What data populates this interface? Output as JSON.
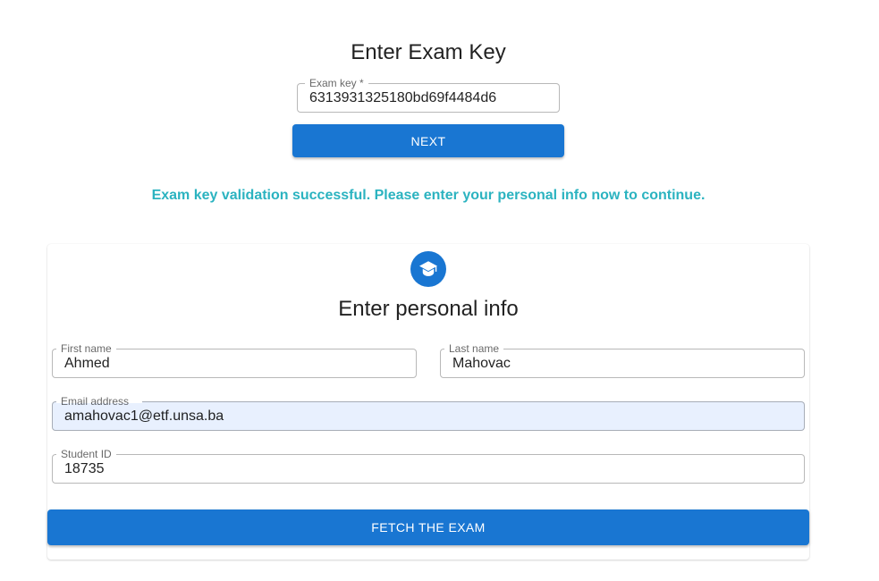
{
  "exam_key_section": {
    "title": "Enter Exam Key",
    "exam_key_label": "Exam key *",
    "exam_key_value": "6313931325180bd69f4484d6",
    "next_button": "NEXT"
  },
  "status": {
    "success_message": "Exam key validation successful. Please enter your personal info now to continue."
  },
  "personal_info": {
    "icon": "graduation-cap-icon",
    "title": "Enter personal info",
    "first_name_label": "First name",
    "first_name_value": "Ahmed",
    "last_name_label": "Last name",
    "last_name_value": "Mahovac",
    "email_label": "Email address",
    "email_value": "amahovac1@etf.unsa.ba",
    "student_id_label": "Student ID",
    "student_id_value": "18735",
    "fetch_button": "FETCH THE EXAM"
  },
  "colors": {
    "primary": "#1976d2",
    "success_text": "#2bb3c0",
    "autofill_bg": "#e8f0fe"
  }
}
